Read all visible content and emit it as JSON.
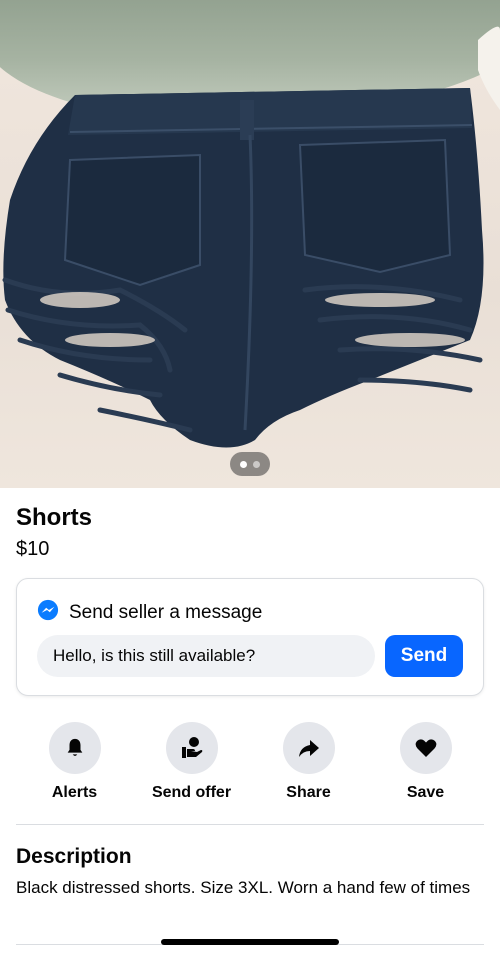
{
  "listing": {
    "title": "Shorts",
    "price": "$10",
    "photo_count": 2,
    "photo_index": 1
  },
  "message": {
    "heading": "Send seller a message",
    "input_value": "Hello, is this still available?",
    "send_label": "Send",
    "icon": "messenger-icon"
  },
  "actions": [
    {
      "label": "Alerts",
      "icon": "bell-icon"
    },
    {
      "label": "Send offer",
      "icon": "offer-hand-icon"
    },
    {
      "label": "Share",
      "icon": "share-arrow-icon"
    },
    {
      "label": "Save",
      "icon": "heart-icon"
    }
  ],
  "description": {
    "title": "Description",
    "text": "Black distressed shorts. Size 3XL. Worn a hand few of times"
  },
  "colors": {
    "accent": "#0866ff",
    "action_bg": "#e4e6eb",
    "input_bg": "#f0f2f5"
  }
}
